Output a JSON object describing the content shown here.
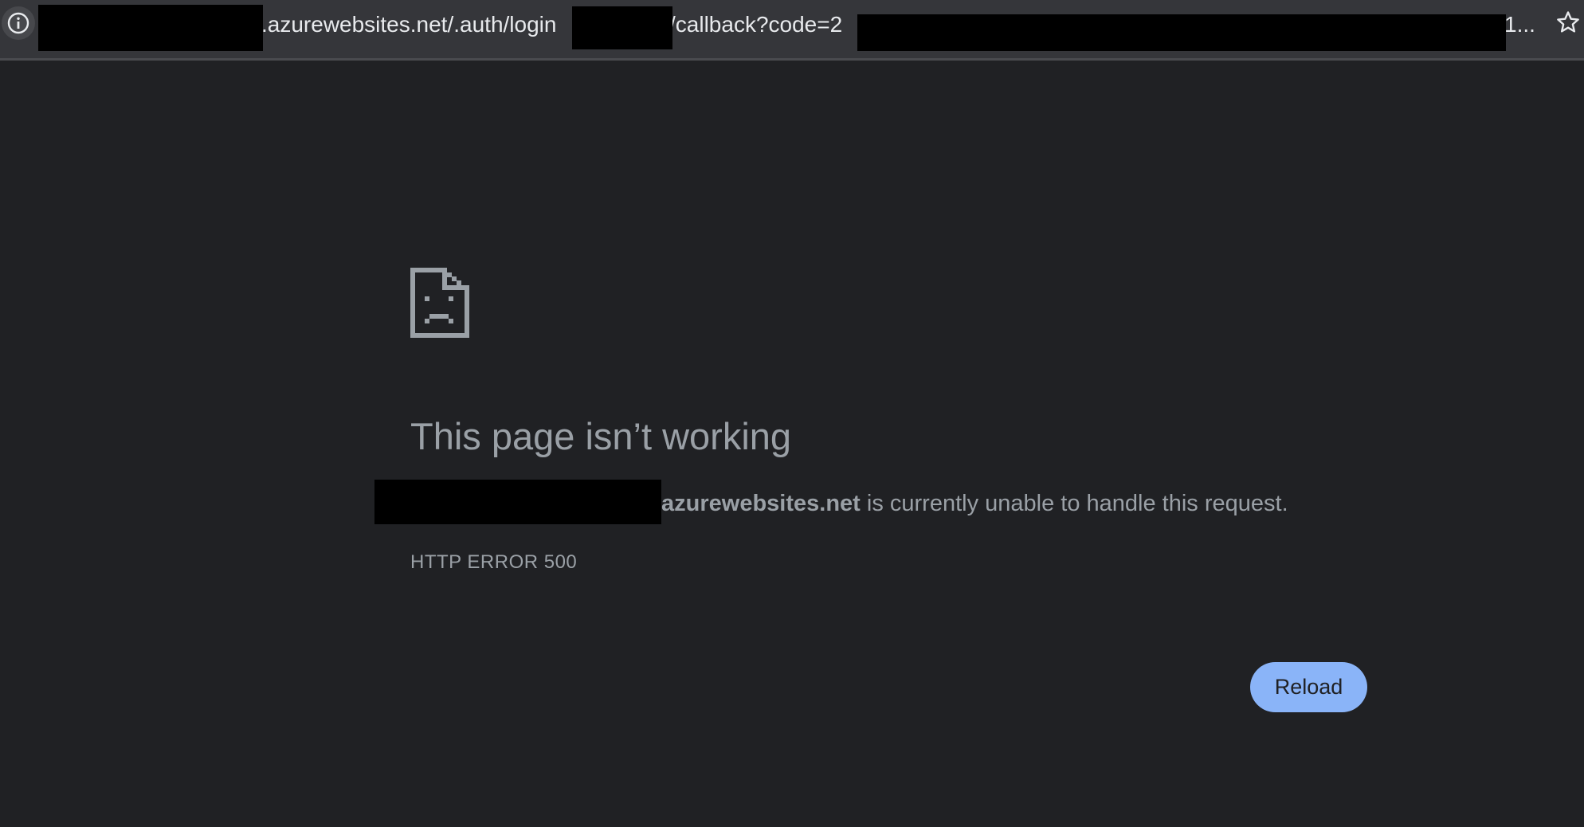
{
  "browser": {
    "site_info_icon": "info-icon",
    "url": {
      "segment_domain": ".azurewebsites.net/.auth/login",
      "segment_callback": "/callback?code=2",
      "segment_tail": "1..."
    },
    "bookmark_icon": "star-outline-icon"
  },
  "error_page": {
    "icon": "sad-page-icon",
    "headline": "This page isn’t working",
    "host": "azurewebsites.net",
    "message": " is currently unable to handle this request.",
    "error_code": "HTTP ERROR 500",
    "reload_label": "Reload"
  },
  "colors": {
    "background": "#202124",
    "toolbar": "#35363a",
    "text": "#9aa0a6",
    "button": "#8ab4f8"
  }
}
